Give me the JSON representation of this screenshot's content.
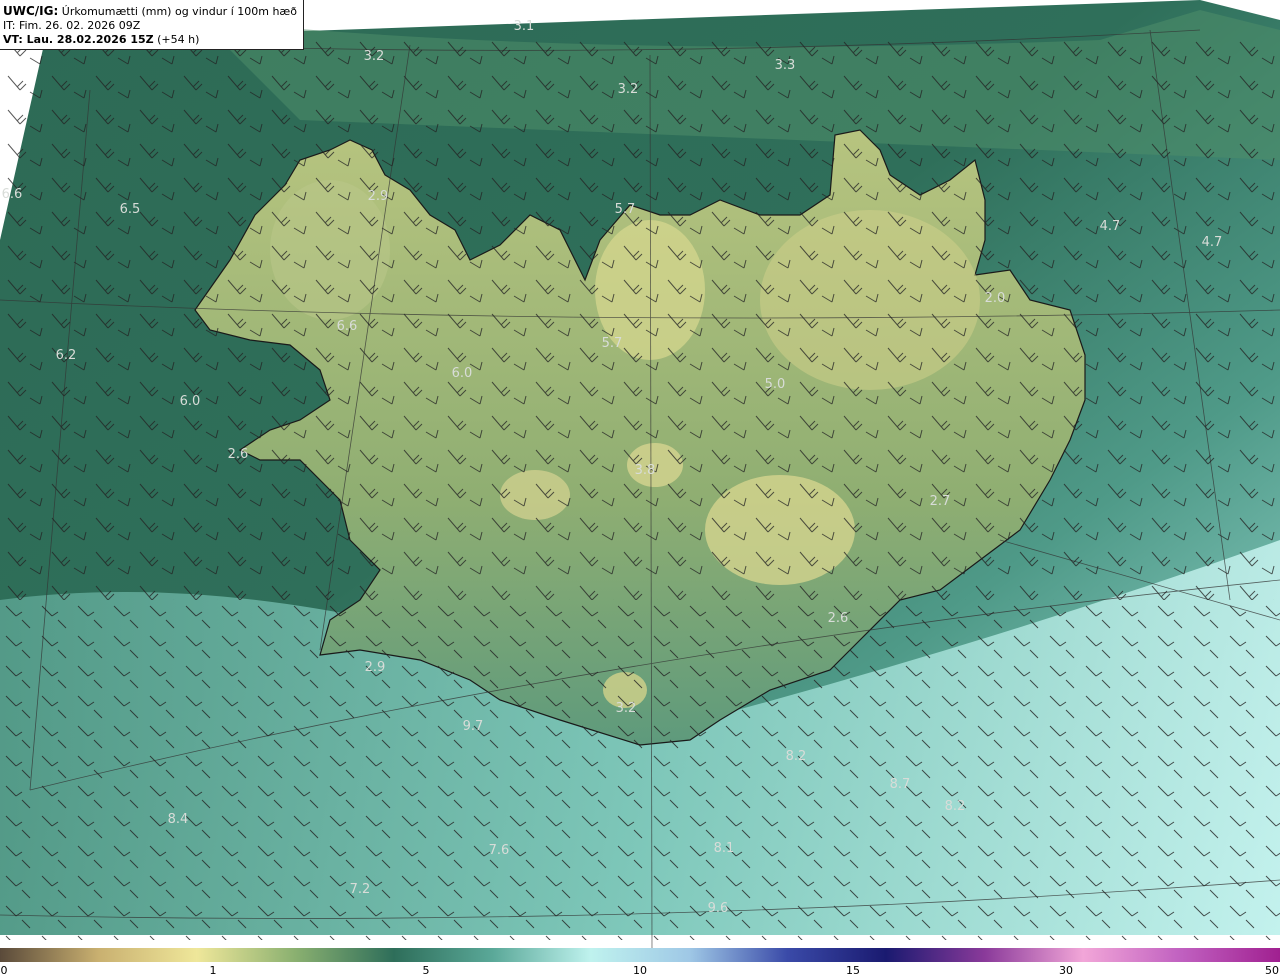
{
  "header": {
    "model": "UWC/IG:",
    "title": "Úrkomumætti (mm) og vindur í 100m hæð",
    "issue_time": "IT: Fim. 26. 02. 2026 09Z",
    "valid_prefix": "VT: Lau. 28.02.2026 15Z",
    "valid_offset": "(+54 h)"
  },
  "value_labels": [
    "3.1",
    "3.2",
    "3.3",
    "3.2",
    "6.6",
    "6.5",
    "2.9",
    "5.7",
    "4.7",
    "4.7",
    "6.6",
    "6.2",
    "6.0",
    "6.0",
    "5.7",
    "5.0",
    "2.0",
    "2.6",
    "3.2",
    "2.6",
    "2.7",
    "8.4",
    "7.6",
    "7.2",
    "8.1",
    "8.2",
    "8.7",
    "9.6",
    "8.2",
    "9.7",
    "2.9",
    "3.8"
  ],
  "colorbar": {
    "ticks": [
      "0",
      "1",
      "5",
      "10",
      "15",
      "30",
      "50"
    ],
    "colors": [
      "#5a4a3a",
      "#c9b070",
      "#efe79a",
      "#8ab070",
      "#2e6e5a",
      "#5aa898",
      "#bff2ee",
      "#9fc8e6",
      "#3a4aa8",
      "#1a1a70",
      "#8a3a9a",
      "#f2a6d8",
      "#c060c0",
      "#a02090"
    ]
  },
  "map": {
    "background_colors": [
      "#2b6a55",
      "#3d7d5d",
      "#7aa870",
      "#c3cf88",
      "#5fa293",
      "#a6e1da"
    ],
    "coastline_color": "#1a1a1a",
    "wind_barb_color": "#1a1a1a"
  }
}
